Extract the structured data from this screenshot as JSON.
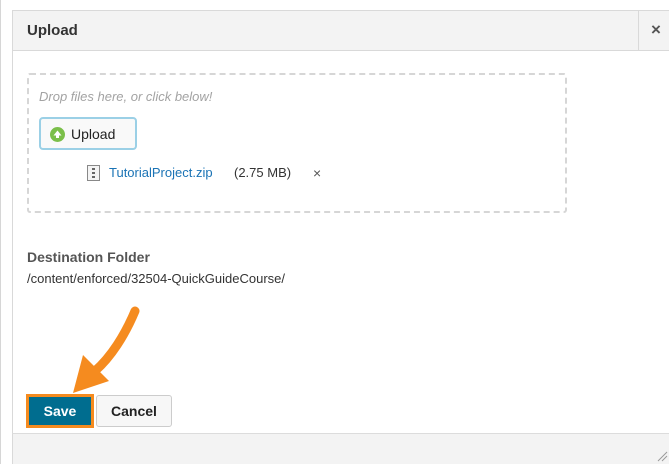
{
  "dialog": {
    "title": "Upload",
    "close_label": "×"
  },
  "dropzone": {
    "hint": "Drop files here, or click below!",
    "upload_button_label": "Upload",
    "file": {
      "name": "TutorialProject.zip",
      "size": "(2.75 MB)",
      "remove_label": "×"
    }
  },
  "destination": {
    "label": "Destination Folder",
    "path": "/content/enforced/32504-QuickGuideCourse/"
  },
  "actions": {
    "save_label": "Save",
    "cancel_label": "Cancel"
  },
  "colors": {
    "save_bg": "#006d8f",
    "highlight": "#f58b1f",
    "upload_icon": "#7bbf4a",
    "link": "#1a73b5"
  },
  "icons": {
    "upload": "upload-arrow-circle-icon",
    "file": "zip-file-icon",
    "annotation": "orange-arrow-icon",
    "resize": "resize-grip-icon"
  }
}
